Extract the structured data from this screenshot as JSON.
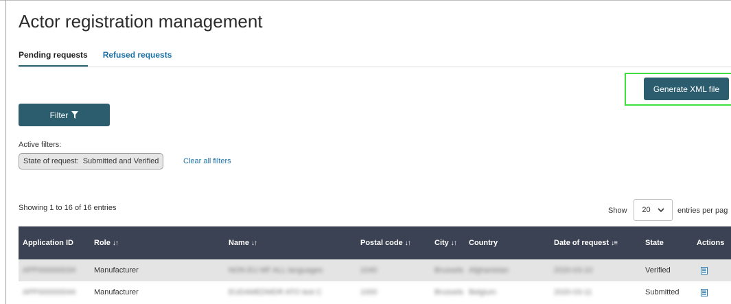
{
  "page": {
    "title": "Actor registration management"
  },
  "tabs": [
    {
      "label": "Pending requests",
      "active": true
    },
    {
      "label": "Refused requests",
      "active": false
    }
  ],
  "actions": {
    "generate_xml": "Generate XML file",
    "filter": "Filter"
  },
  "filters": {
    "active_label": "Active filters:",
    "chip_key": "State of request:",
    "chip_value": "Submitted and Verified",
    "clear_all": "Clear all filters"
  },
  "pagination": {
    "showing": "Showing 1 to 16 of 16 entries",
    "show_label": "Show",
    "page_size": "20",
    "entries_label": "entries per pag"
  },
  "table": {
    "headers": {
      "application_id": "Application ID",
      "role": "Role",
      "name": "Name",
      "postal_code": "Postal code",
      "city": "City",
      "country": "Country",
      "date": "Date of request",
      "state": "State",
      "actions": "Actions"
    },
    "rows": [
      {
        "application_id": "APP000000034",
        "role": "Manufacturer",
        "name": "NON EU MF ALL languages",
        "postal_code": "1040",
        "city": "Brussels",
        "country": "Afghanistan",
        "date": "2020-03-10",
        "state": "Verified"
      },
      {
        "application_id": "APP000000044",
        "role": "Manufacturer",
        "name": "EUDAMEDMDR ATO test C",
        "postal_code": "1000",
        "city": "Brussels",
        "country": "Belgium",
        "date": "2020-03-11",
        "state": "Submitted"
      }
    ]
  },
  "colors": {
    "primary_button": "#2b5d6e",
    "table_header": "#3b4253",
    "link": "#1a6fa3",
    "highlight": "#3ee03e"
  },
  "icons": {
    "filter": "funnel-icon",
    "sort": "sort-arrows-icon",
    "row_action": "document-icon",
    "dropdown": "chevron-down-icon"
  }
}
